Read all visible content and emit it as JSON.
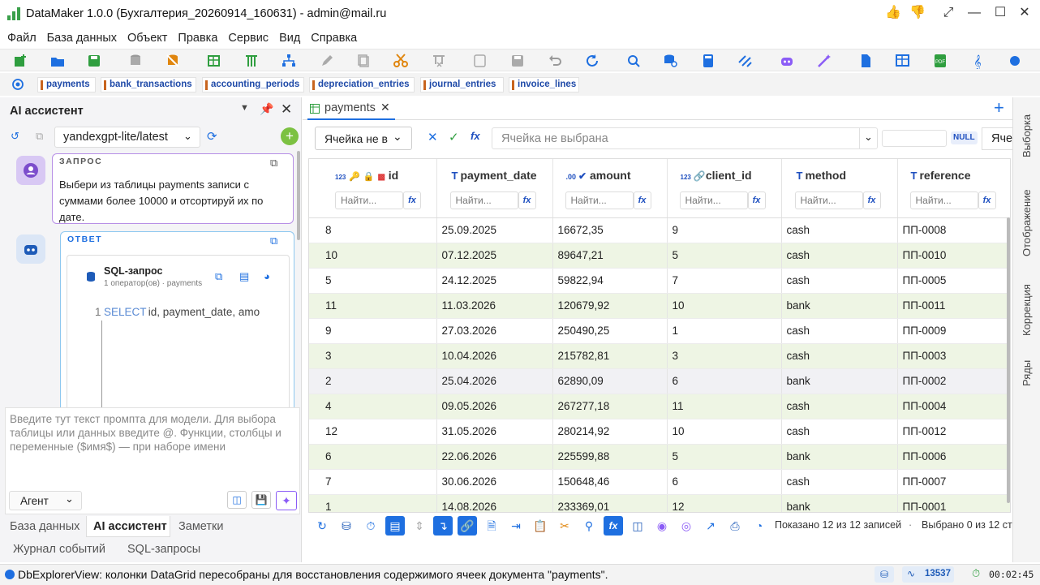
{
  "window": {
    "title": "DataMaker 1.0.0 (Бухгалтерия_20260914_160631) - admin@mail.ru"
  },
  "menu": [
    "Файл",
    "База данных",
    "Объект",
    "Правка",
    "Сервис",
    "Вид",
    "Справка"
  ],
  "table_tabs": [
    "payments",
    "bank_transactions",
    "accounting_periods",
    "depreciation_entries",
    "journal_entries",
    "invoice_lines"
  ],
  "ai_panel": {
    "title": "AI ассистент",
    "model": "yandexgpt-lite/latest",
    "query_label": "ЗАПРОС",
    "query_text": "Выбери из таблицы payments записи с суммами более 10000 и отсортируй их по дате.",
    "answer_label": "ОТВЕТ",
    "sql_title": "SQL-запрос",
    "sql_subtitle": "1 оператор(ов) · payments",
    "line_no": "1",
    "sql_keyword": "SELECT",
    "sql_rest": " id, payment_date, amo",
    "prompt_placeholder": "Введите тут текст промпта для модели. Для выбора таблицы или данных введите @. Функции, столбцы и переменные ($имя$) — при наборе имени",
    "mode": "Агент"
  },
  "left_tabs": [
    "База данных",
    "AI ассистент",
    "Заметки"
  ],
  "left_tabs2": [
    "Журнал событий",
    "SQL-запросы"
  ],
  "doc_tab": "payments",
  "cell_bar": {
    "cell_select": "Ячейка не вы",
    "cell_value_placeholder": "Ячейка не выбрана",
    "null_badge": "NULL",
    "right_cut": "Яче"
  },
  "grid": {
    "find_placeholder": "Найти...",
    "fx": "fx",
    "columns": [
      {
        "name": "id",
        "type": "123"
      },
      {
        "name": "payment_date",
        "type": "T"
      },
      {
        "name": "amount",
        "type": ".00"
      },
      {
        "name": "client_id",
        "type": "123"
      },
      {
        "name": "method",
        "type": "T"
      },
      {
        "name": "reference",
        "type": "T"
      }
    ],
    "rows": [
      [
        "8",
        "25.09.2025",
        "16672,35",
        "9",
        "cash",
        "ПП-0008"
      ],
      [
        "10",
        "07.12.2025",
        "89647,21",
        "5",
        "cash",
        "ПП-0010"
      ],
      [
        "5",
        "24.12.2025",
        "59822,94",
        "7",
        "cash",
        "ПП-0005"
      ],
      [
        "11",
        "11.03.2026",
        "120679,92",
        "10",
        "bank",
        "ПП-0011"
      ],
      [
        "9",
        "27.03.2026",
        "250490,25",
        "1",
        "cash",
        "ПП-0009"
      ],
      [
        "3",
        "10.04.2026",
        "215782,81",
        "3",
        "cash",
        "ПП-0003"
      ],
      [
        "2",
        "25.04.2026",
        "62890,09",
        "6",
        "bank",
        "ПП-0002"
      ],
      [
        "4",
        "09.05.2026",
        "267277,18",
        "11",
        "cash",
        "ПП-0004"
      ],
      [
        "12",
        "31.05.2026",
        "280214,92",
        "10",
        "cash",
        "ПП-0012"
      ],
      [
        "6",
        "22.06.2026",
        "225599,88",
        "5",
        "bank",
        "ПП-0006"
      ],
      [
        "7",
        "30.06.2026",
        "150648,46",
        "6",
        "cash",
        "ПП-0007"
      ],
      [
        "1",
        "14.08.2026",
        "233369,01",
        "12",
        "bank",
        "ПП-0001"
      ]
    ]
  },
  "grid_status": {
    "shown": "Показано 12 из 12 записей",
    "sep": "·",
    "selected": "Выбрано 0 из 12 ст"
  },
  "right_rail": [
    "Выборка",
    "Отображение",
    "Коррекция",
    "Ряды"
  ],
  "status": {
    "message": "DbExplorerView: колонки DataGrid пересобраны для восстановления содержимого ячеек документа \"payments\".",
    "count": "13537",
    "timer": "00:02:45"
  },
  "colors": {
    "accent": "#1e6fe0",
    "green": "#2f9e3f",
    "row_alt": "#eef5e4",
    "purple": "#8b5cf6"
  }
}
